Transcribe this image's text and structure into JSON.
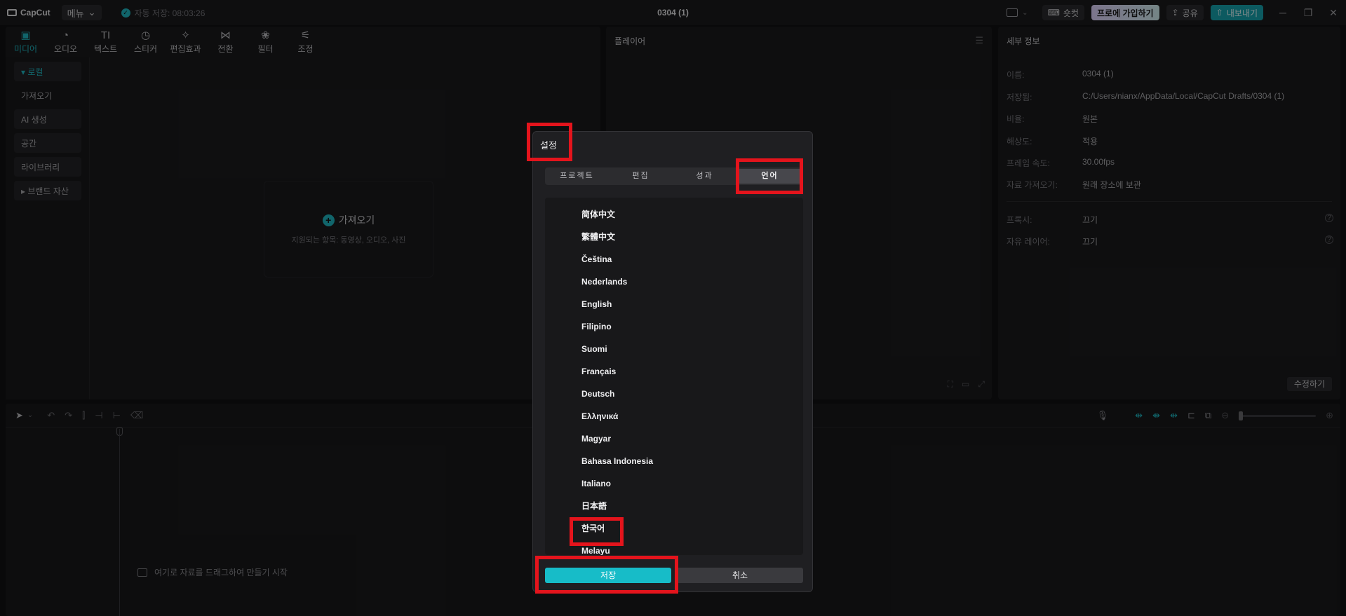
{
  "titlebar": {
    "logo": "CapCut",
    "menu_label": "메뉴",
    "autosave": "자동 저장: 08:03:26",
    "document_title": "0304 (1)",
    "shortcut_label": "숏컷",
    "pro_label": "프로에 가입하기",
    "share_label": "공유",
    "export_label": "내보내기"
  },
  "media": {
    "tabs": [
      {
        "icon": "media-icon",
        "glyph": "▣",
        "label": "미디어"
      },
      {
        "icon": "audio-icon",
        "glyph": "◔",
        "label": "오디오"
      },
      {
        "icon": "text-icon",
        "glyph": "TI",
        "label": "텍스트"
      },
      {
        "icon": "sticker-icon",
        "glyph": "◷",
        "label": "스티커"
      },
      {
        "icon": "effects-icon",
        "glyph": "✧",
        "label": "편집효과"
      },
      {
        "icon": "transition-icon",
        "glyph": "⋈",
        "label": "전환"
      },
      {
        "icon": "filter-icon",
        "glyph": "❀",
        "label": "필터"
      },
      {
        "icon": "adjust-icon",
        "glyph": "⚟",
        "label": "조정"
      }
    ],
    "sidebar": [
      {
        "label": "▾ 로컬"
      },
      {
        "label": "가져오기"
      },
      {
        "label": "AI 생성"
      },
      {
        "label": "공간"
      },
      {
        "label": "라이브러리"
      },
      {
        "label": "▸ 브랜드 자산"
      }
    ],
    "import_title": "가져오기",
    "import_sub": "지원되는 항목: 동영상, 오디오, 사진"
  },
  "player": {
    "title": "플레이어"
  },
  "details": {
    "title": "세부 정보",
    "rows": [
      {
        "k": "이름:",
        "v": "0304 (1)"
      },
      {
        "k": "저장됨:",
        "v": "C:/Users/nianx/AppData/Local/CapCut Drafts/0304 (1)"
      },
      {
        "k": "비율:",
        "v": "원본"
      },
      {
        "k": "해상도:",
        "v": "적용"
      },
      {
        "k": "프레임 속도:",
        "v": "30.00fps"
      },
      {
        "k": "자료 가져오기:",
        "v": "원래 장소에 보관"
      }
    ],
    "rows2": [
      {
        "k": "프록시:",
        "v": "끄기"
      },
      {
        "k": "자유 레이어:",
        "v": "끄기"
      }
    ],
    "edit_label": "수정하기"
  },
  "timeline": {
    "drop_hint": "여기로 자료를 드래그하여 만들기 시작"
  },
  "dialog": {
    "title": "설정",
    "tabs": [
      "프로젝트",
      "편집",
      "성과",
      "언어"
    ],
    "active_tab": "언어",
    "languages": [
      "简体中文",
      "繁體中文",
      "Čeština",
      "Nederlands",
      "English",
      "Filipino",
      "Suomi",
      "Français",
      "Deutsch",
      "Ελληνικά",
      "Magyar",
      "Bahasa Indonesia",
      "Italiano",
      "日本語",
      "한국어",
      "Melayu"
    ],
    "selected_language": "한국어",
    "save_label": "저장",
    "cancel_label": "취소"
  },
  "colors": {
    "accent": "#1fb9c4",
    "highlight": "#e4141c"
  }
}
